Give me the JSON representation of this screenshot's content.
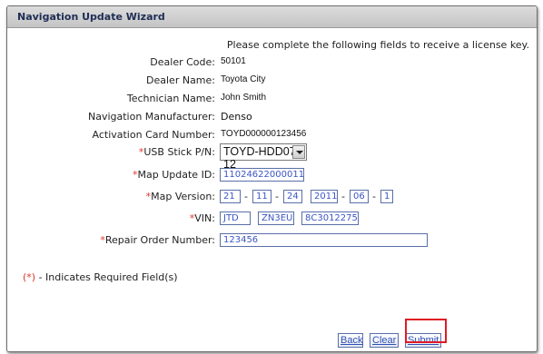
{
  "wizard": {
    "title": "Navigation Update Wizard",
    "instruction": "Please complete the following fields to receive a license key."
  },
  "fields": {
    "dealer_code": {
      "label": "Dealer Code:",
      "value": "50101"
    },
    "dealer_name": {
      "label": "Dealer Name:",
      "value": "Toyota City"
    },
    "technician_name": {
      "label": "Technician Name:",
      "value": "John Smith"
    },
    "nav_manufacturer": {
      "label": "Navigation Manufacturer:",
      "value": "Denso"
    },
    "activation_card": {
      "label": "Activation Card Number:",
      "value": "TOYD000000123456"
    },
    "usb_stick": {
      "req": "*",
      "label": "USB Stick P/N:",
      "selected": "TOYD-HDD07-12"
    },
    "map_update_id": {
      "req": "*",
      "label": "Map Update ID:",
      "value": "1102462200001111"
    },
    "map_version": {
      "req": "*",
      "label": "Map Version:",
      "parts": [
        "21",
        "11",
        "24",
        "2011",
        "06",
        "1"
      ],
      "separator": "-"
    },
    "vin": {
      "req": "*",
      "label": "VIN:",
      "parts": [
        "JTD",
        "ZN3EU",
        "8C3012275"
      ]
    },
    "repair_order": {
      "req": "*",
      "label": "Repair Order Number:",
      "value": "123456"
    }
  },
  "note": {
    "req": "(*)",
    "text": " - Indicates Required Field(s)"
  },
  "buttons": {
    "back": "Back",
    "clear": "Clear",
    "submit": "Submit"
  },
  "colors": {
    "required": "#e0342c",
    "highlight": "#e01b24",
    "link": "#2f4fb5"
  }
}
